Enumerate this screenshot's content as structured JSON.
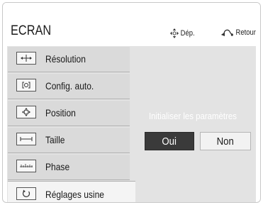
{
  "header": {
    "title": "ECRAN",
    "move_hint": "Dép.",
    "back_hint": "Retour"
  },
  "menu": {
    "items": [
      {
        "label": "Résolution",
        "icon": "resolution-icon"
      },
      {
        "label": "Config. auto.",
        "icon": "auto-config-icon"
      },
      {
        "label": "Position",
        "icon": "position-icon"
      },
      {
        "label": "Taille",
        "icon": "size-icon"
      },
      {
        "label": "Phase",
        "icon": "phase-icon"
      },
      {
        "label": "Réglages usine",
        "icon": "factory-reset-icon"
      }
    ],
    "selected": "Réglages usine"
  },
  "dialog": {
    "prompt": "Initialiser les paramètres",
    "yes_label": "Oui",
    "no_label": "Non",
    "focused": "Oui"
  },
  "colors": {
    "panel_bg": "#e3e3e3",
    "focused_button": "#3a3a3a",
    "unfocused_button": "#f2f2f2"
  }
}
